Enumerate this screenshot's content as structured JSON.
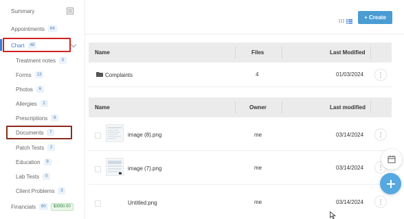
{
  "sidebar": {
    "items": [
      {
        "label": "Summary",
        "badge": ""
      },
      {
        "label": "Appointments",
        "badge": "64"
      },
      {
        "label": "Chart",
        "badge": "48"
      },
      {
        "label": "Treatment notes",
        "badge": "5"
      },
      {
        "label": "Forms",
        "badge": "13"
      },
      {
        "label": "Photos",
        "badge": "6"
      },
      {
        "label": "Allergies",
        "badge": "2"
      },
      {
        "label": "Prescriptions",
        "badge": "6"
      },
      {
        "label": "Documents",
        "badge": "7"
      },
      {
        "label": "Patch Tests",
        "badge": "2"
      },
      {
        "label": "Education",
        "badge": "9"
      },
      {
        "label": "Lab Tests",
        "badge": "0"
      },
      {
        "label": "Client Problems",
        "badge": "3"
      },
      {
        "label": "Financials",
        "badge": "60",
        "badge2": "$3950.00"
      }
    ]
  },
  "toolbar": {
    "create_label": "+ Create"
  },
  "folders_table": {
    "headers": {
      "name": "Name",
      "files": "Files",
      "modified": "Last Modified"
    },
    "rows": [
      {
        "name": "Complaints",
        "files": "4",
        "modified": "01/03/2024"
      }
    ]
  },
  "files_table": {
    "headers": {
      "name": "Name",
      "owner": "Owner",
      "modified": "Last modified"
    },
    "rows": [
      {
        "name": "image (8).png",
        "owner": "me",
        "modified": "03/14/2024"
      },
      {
        "name": "image (7).png",
        "owner": "me",
        "modified": "03/14/2024"
      },
      {
        "name": "Untitled.png",
        "owner": "me",
        "modified": "03/14/2024"
      }
    ]
  },
  "more_glyph": "⋮",
  "colors": {
    "accent": "#3a7bd5",
    "create_button": "#4b9cd3",
    "highlight_red": "#d02020",
    "highlight_brown": "#8b2a1a"
  }
}
